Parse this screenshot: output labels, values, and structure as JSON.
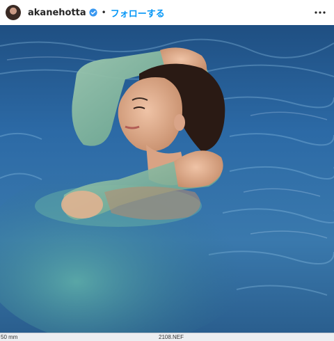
{
  "post_header": {
    "username": "akanehotta",
    "verified_icon": "verified-badge-icon",
    "separator": "•",
    "follow_label": "フォローする",
    "more_icon": "more-options-icon",
    "accent_color": "#0095f6"
  },
  "photo": {
    "description_icon": "post-photo"
  },
  "viewer_bar": {
    "focal_length": "50 mm",
    "file_name": "2108.NEF"
  }
}
